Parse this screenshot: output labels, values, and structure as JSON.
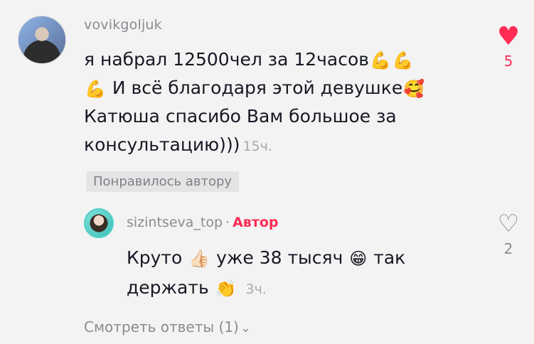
{
  "comment": {
    "username": "vovikgoljuk",
    "line1": "я набрал 12500чел за 12часов",
    "line2": "И всё благодаря этой девушке",
    "line3": "Катюша спасибо Вам большое за",
    "line4": "консультацию)))",
    "time": "15ч.",
    "liked_by_author": "Понравилось автору",
    "like_count": "5",
    "emojis": {
      "muscle": "💪",
      "smiling_hearts": "🥰"
    }
  },
  "reply": {
    "username": "sizintseva_top",
    "separator": "·",
    "author_label": "Автор",
    "text1": "Круто",
    "text2": "уже 38 тысяч",
    "text3": "так",
    "text4": "держать",
    "time": "3ч.",
    "like_count": "2",
    "emojis": {
      "thumbs_up": "👍🏻",
      "grin": "😁",
      "clap": "👏"
    }
  },
  "view_replies": "Смотреть ответы (1)",
  "icons": {
    "heart_filled": "♥",
    "heart_outline": "♡",
    "chevron_down": "⌄"
  },
  "colors": {
    "accent": "#fe2c55",
    "muted": "#8a8b91",
    "background": "#f3f3f3"
  }
}
